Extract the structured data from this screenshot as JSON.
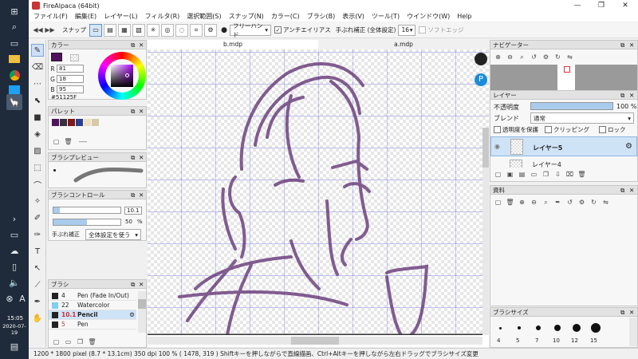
{
  "taskbar": {
    "time": "15:05",
    "date": "2020-07-19"
  },
  "window": {
    "title": "FireAlpaca (64bit)"
  },
  "menus": [
    "ファイル(F)",
    "編集(E)",
    "レイヤー(L)",
    "フィルタ(R)",
    "選択範囲(S)",
    "スナップ(N)",
    "カラー(C)",
    "ブラシ(B)",
    "表示(V)",
    "ツール(T)",
    "ウインドウ(W)",
    "Help"
  ],
  "toolbar": {
    "snap_label": "スナップ",
    "stroke_mode": "フリーハンド",
    "antialias_label": "アンチエイリアス",
    "correction_label": "手ぶれ補正 (全体設定)",
    "correction_value": "16",
    "soft_edge_label": "ソフトエッジ"
  },
  "color_panel": {
    "title": "カラー",
    "r_label": "R",
    "r": "81",
    "g_label": "G",
    "g": "18",
    "b_label": "B",
    "b": "95",
    "hex": "#51125F",
    "fg_color": "#51125F"
  },
  "palette_panel": {
    "title": "パレット",
    "swatches": [
      "#51125F",
      "#3a2f3f",
      "#7a1a1a",
      "#2b3f8f",
      "#efe0c0",
      "#d8c9a8"
    ],
    "dashes": "----"
  },
  "brush_preview_panel": {
    "title": "ブラシプレビュー"
  },
  "brush_control_panel": {
    "title": "ブラシコントロール",
    "size": "10.1",
    "opacity": "50",
    "opacity_unit": "%",
    "correction_label": "手ぶれ補正",
    "correction_value": "全体設定を使う",
    "size_fill": 0.1,
    "opacity_fill": 0.5
  },
  "brush_panel": {
    "title": "ブラシ",
    "items": [
      {
        "size": "4",
        "name": "Pen (Fade In/Out)"
      },
      {
        "size": "22",
        "name": "Watercolor"
      },
      {
        "size": "10.1",
        "name": "Pencil"
      },
      {
        "size": "5",
        "name": "Pen"
      }
    ]
  },
  "canvas": {
    "tabs": [
      "b.mdp",
      "a.mdp"
    ]
  },
  "navigator_panel": {
    "title": "ナビゲーター"
  },
  "layer_panel": {
    "title": "レイヤー",
    "opacity_label": "不透明度",
    "opacity_value": "100 %",
    "opacity_fill": 1.0,
    "blend_label": "ブレンド",
    "blend_value": "通常",
    "protect_label": "透明度を保護",
    "clipping_label": "クリッピング",
    "lock_label": "ロック",
    "layers": [
      "レイヤー5",
      "レイヤー4"
    ]
  },
  "material_panel": {
    "title": "資料"
  },
  "brush_size_panel": {
    "title": "ブラシサイズ",
    "sizes": [
      "4",
      "5",
      "7",
      "10",
      "12",
      "15"
    ]
  },
  "status": {
    "text": "1200 * 1800 pixel  (8.7 * 13.1cm)  350 dpi  100 %  ( 1478, 319 )  Shiftキーを押しながらで直線描画、Ctrl+Altキーを押しながら左右ドラッグでブラシサイズ変更"
  }
}
